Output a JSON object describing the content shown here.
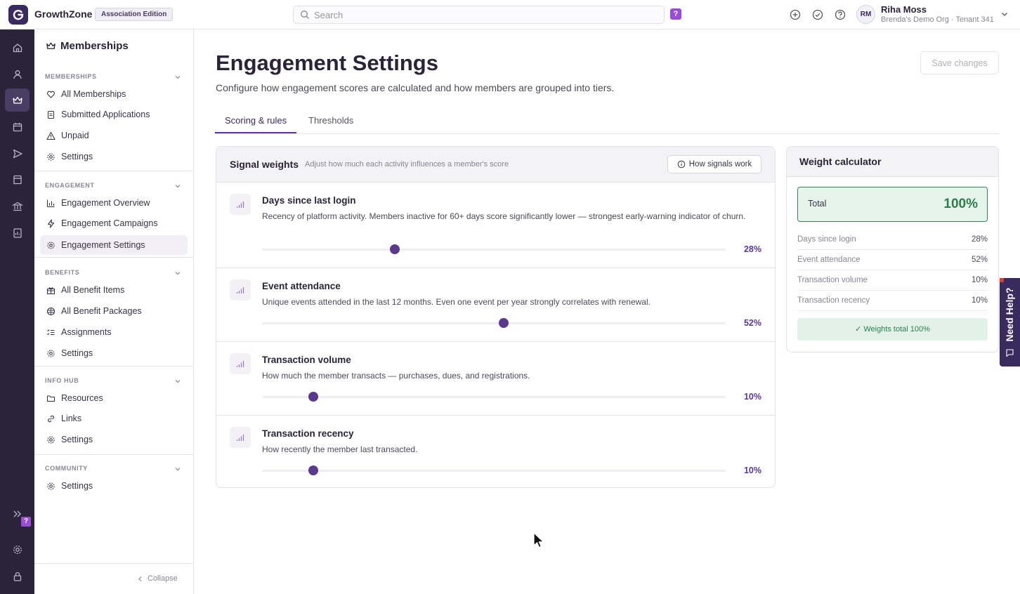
{
  "topbar": {
    "brand": "GrowthZone",
    "edition": "Association Edition",
    "search_placeholder": "Search",
    "help_badge": "?",
    "icons": [
      "plus-circle-icon",
      "check-circle-icon",
      "question-circle-icon"
    ],
    "user": {
      "initials": "RM",
      "name": "Riha Moss",
      "org": "Brenda's Demo Org · Tenant 341"
    }
  },
  "rail": {
    "icons": [
      "home-icon",
      "person-icon",
      "crown-icon",
      "calendar-icon",
      "send-icon",
      "store-icon",
      "bank-icon",
      "report-icon"
    ],
    "active": "crown-icon",
    "expand_icon": "double-chevron-right-icon",
    "help_badge": "?",
    "bottom_icons": [
      "gear-icon",
      "lock-icon"
    ]
  },
  "sidebar": {
    "title": "Memberships",
    "sections": [
      {
        "heading": "MEMBERSHIPS",
        "items": [
          {
            "label": "All Memberships",
            "icon": "heart-icon"
          },
          {
            "label": "Submitted Applications",
            "icon": "document-icon"
          },
          {
            "label": "Unpaid",
            "icon": "warning-icon"
          },
          {
            "label": "Settings",
            "icon": "gear-icon"
          }
        ]
      },
      {
        "heading": "ENGAGEMENT",
        "items": [
          {
            "label": "Engagement Overview",
            "icon": "bar-chart-icon"
          },
          {
            "label": "Engagement Campaigns",
            "icon": "lightning-icon"
          },
          {
            "label": "Engagement Settings",
            "icon": "gear-icon",
            "active": true
          }
        ]
      },
      {
        "heading": "BENEFITS",
        "items": [
          {
            "label": "All Benefit Items",
            "icon": "gift-icon"
          },
          {
            "label": "All Benefit Packages",
            "icon": "package-icon"
          },
          {
            "label": "Assignments",
            "icon": "checklist-icon"
          },
          {
            "label": "Settings",
            "icon": "gear-icon"
          }
        ]
      },
      {
        "heading": "INFO HUB",
        "items": [
          {
            "label": "Resources",
            "icon": "folder-icon"
          },
          {
            "label": "Links",
            "icon": "link-icon"
          },
          {
            "label": "Settings",
            "icon": "gear-icon"
          }
        ]
      },
      {
        "heading": "COMMUNITY",
        "items": [
          {
            "label": "Settings",
            "icon": "gear-icon"
          }
        ]
      }
    ],
    "collapse_label": "Collapse"
  },
  "main": {
    "title": "Engagement Settings",
    "subtitle": "Configure how engagement scores are calculated and how members are grouped into tiers.",
    "save_label": "Save changes",
    "tabs": [
      {
        "label": "Scoring & rules",
        "active": true
      },
      {
        "label": "Thresholds"
      }
    ],
    "signals_card": {
      "title": "Signal weights",
      "subtitle": "Adjust how much each activity influences a member's score",
      "how_button": "How signals work",
      "signals": [
        {
          "name": "Days since last login",
          "description": "Recency of platform activity. Members inactive for 60+ days score significantly lower — strongest early-warning indicator of churn.",
          "slider_position": 0.286,
          "weight": "28%"
        },
        {
          "name": "Event attendance",
          "description": "Unique events attended in the last 12 months. Even one event per year strongly correlates with renewal.",
          "slider_position": 0.521,
          "weight": "52%"
        },
        {
          "name": "Transaction volume",
          "description": "How much the member transacts — purchases, dues, and registrations.",
          "slider_position": 0.11,
          "weight": "10%"
        },
        {
          "name": "Transaction recency",
          "description": "How recently the member last transacted.",
          "slider_position": 0.11,
          "weight": "10%"
        }
      ]
    },
    "calculator": {
      "title": "Weight calculator",
      "total_label": "Total",
      "total_value": "100%",
      "rows": [
        {
          "label": "Days since login",
          "value": "28%"
        },
        {
          "label": "Event attendance",
          "value": "52%"
        },
        {
          "label": "Transaction volume",
          "value": "10%"
        },
        {
          "label": "Transaction recency",
          "value": "10%"
        }
      ],
      "status": "✓ Weights total 100%"
    }
  },
  "need_help": {
    "label": "Need Help?"
  },
  "colors": {
    "accent": "#5b3a8e",
    "rail": "#2b2337",
    "success": "#2e7d4f",
    "badge": "#9b4dd6"
  }
}
